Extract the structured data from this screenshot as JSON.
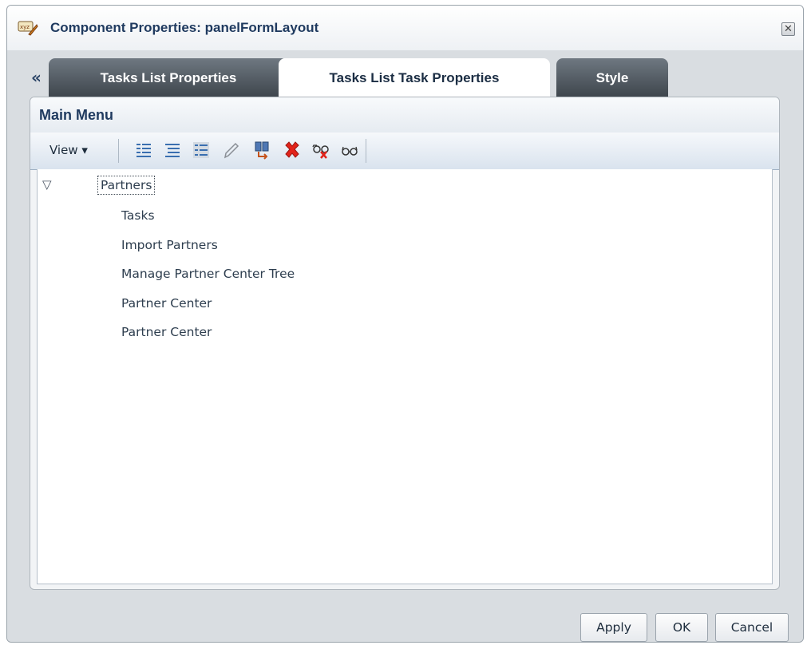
{
  "dialog": {
    "title": "Component Properties: panelFormLayout",
    "close_icon": "close-icon"
  },
  "tabs": [
    {
      "label": "Tasks List Properties",
      "active": false
    },
    {
      "label": "Tasks List Task Properties",
      "active": true
    },
    {
      "label": "Style",
      "active": false
    }
  ],
  "collapse_glyph": "«",
  "panel": {
    "title": "Main Menu"
  },
  "toolbar": {
    "view_label": "View ▾",
    "icons": [
      "expand-all-icon",
      "collapse-all-icon",
      "indent-icon",
      "edit-icon",
      "insert-icon",
      "delete-icon",
      "hide-icon",
      "show-icon"
    ]
  },
  "tree": {
    "root": "Partners",
    "children": [
      "Tasks",
      "Import Partners",
      "Manage Partner Center Tree",
      "Partner Center",
      "Partner Center"
    ]
  },
  "footer": {
    "apply_label": "Apply",
    "ok_label": "OK",
    "cancel_label": "Cancel"
  },
  "colors": {
    "title_text": "#1f3a5f",
    "active_tab_bg": "#ffffff",
    "inactive_tab_bg": "#4a525a"
  }
}
